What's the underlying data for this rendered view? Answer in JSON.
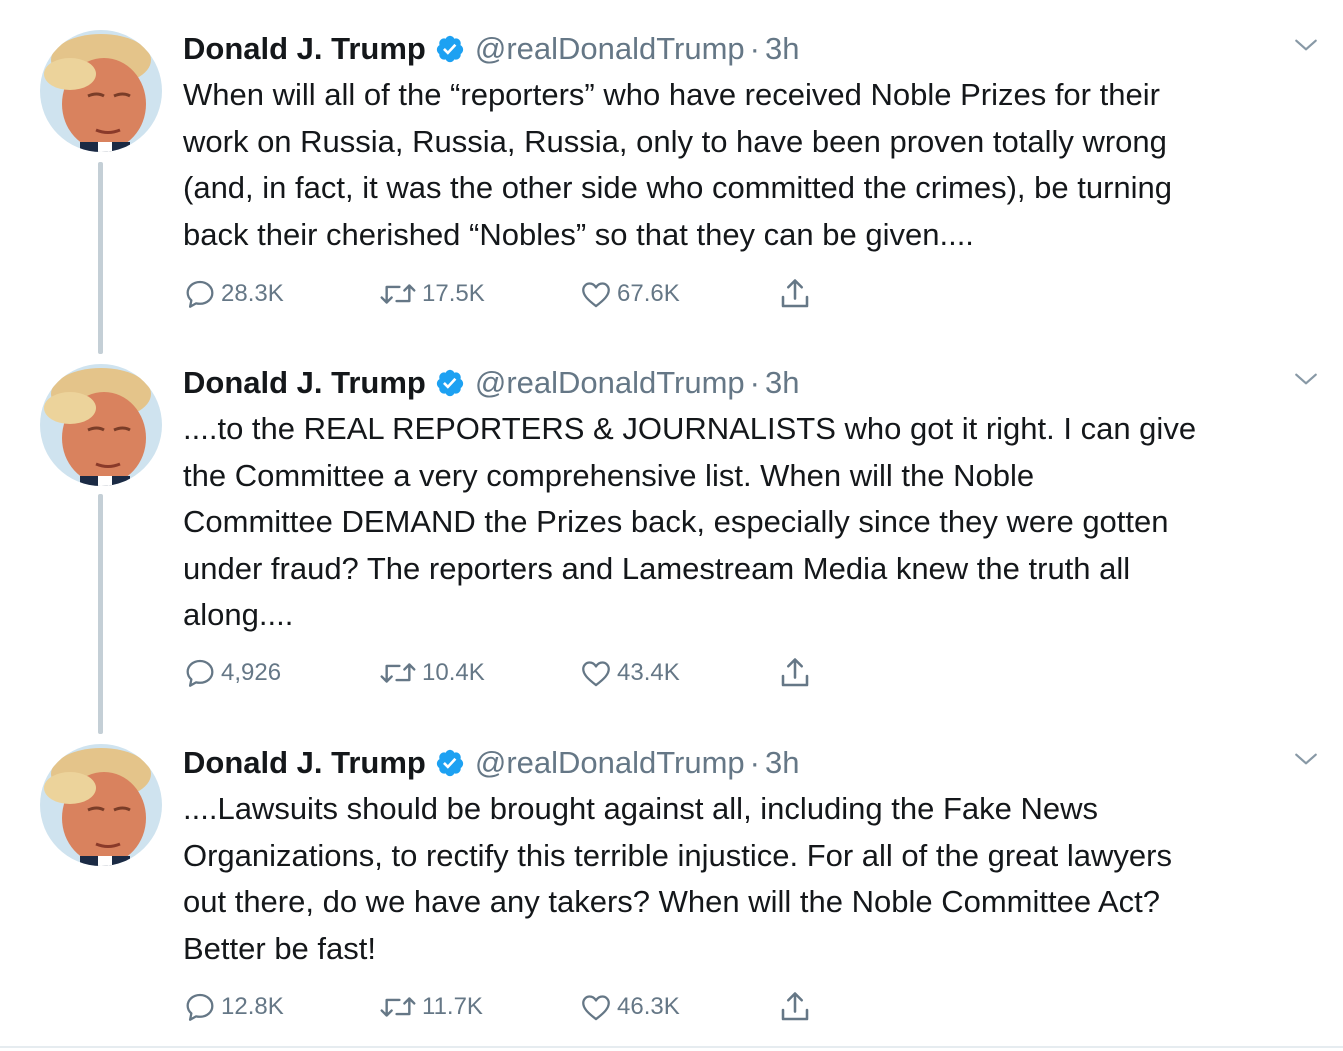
{
  "colors": {
    "verified": "#1da1f2",
    "secondary_text": "#657786",
    "thread_line": "#c4cfd6"
  },
  "tweets": [
    {
      "author_name": "Donald J. Trump",
      "handle": "@realDonaldTrump",
      "separator": "·",
      "time": "3h",
      "lines": [
        "When will all of the “reporters” who have received Noble Prizes for their",
        "work on Russia, Russia, Russia, only to have been proven totally wrong",
        "(and, in fact, it was the other side who committed the crimes), be turning",
        "back their cherished “Nobles” so that they can be given...."
      ],
      "replies": "28.3K",
      "retweets": "17.5K",
      "likes": "67.6K"
    },
    {
      "author_name": "Donald J. Trump",
      "handle": "@realDonaldTrump",
      "separator": "·",
      "time": "3h",
      "lines": [
        "....to the REAL REPORTERS & JOURNALISTS who got it right. I can give",
        "the Committee a very comprehensive list. When will the Noble",
        "Committee DEMAND the Prizes back, especially since they were gotten",
        "under fraud? The reporters and Lamestream Media knew the truth all",
        "along...."
      ],
      "replies": "4,926",
      "retweets": "10.4K",
      "likes": "43.4K"
    },
    {
      "author_name": "Donald J. Trump",
      "handle": "@realDonaldTrump",
      "separator": "·",
      "time": "3h",
      "lines": [
        "....Lawsuits should be brought against all, including the Fake News",
        "Organizations, to rectify this terrible injustice. For all of the great lawyers",
        "out there, do we have any takers? When will the Noble Committee Act?",
        "Better be fast!"
      ],
      "replies": "12.8K",
      "retweets": "11.7K",
      "likes": "46.3K"
    }
  ]
}
